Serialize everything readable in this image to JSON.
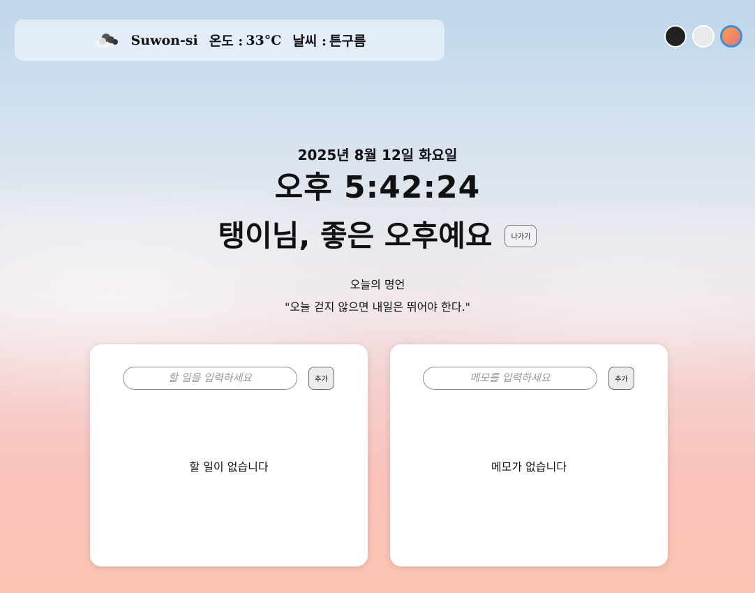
{
  "weather": {
    "icon": "cloud-icon",
    "city": "Suwon-si",
    "temp_label": "온도 :",
    "temp_value": "33°C",
    "weather_label": "날씨 :",
    "weather_value": "튼구름"
  },
  "themes": [
    "dark",
    "light",
    "sunset"
  ],
  "colors": {
    "accent": "#3a8fd8",
    "dark": "#222222",
    "light": "#eaeaea"
  },
  "date": "2025년 8월 12일 화요일",
  "time": "오후 5:42:24",
  "greeting": "탱이님, 좋은 오후예요",
  "logout_label": "나가기",
  "quote_title": "오늘의 명언",
  "quote": "\"오늘 걷지 않으면 내일은 뛰어야 한다.\"",
  "todo": {
    "placeholder": "할 일을 입력하세요",
    "add_label": "추가",
    "empty": "할 일이 없습니다"
  },
  "memo": {
    "placeholder": "메모를 입력하세요",
    "add_label": "추가",
    "empty": "메모가 없습니다"
  }
}
